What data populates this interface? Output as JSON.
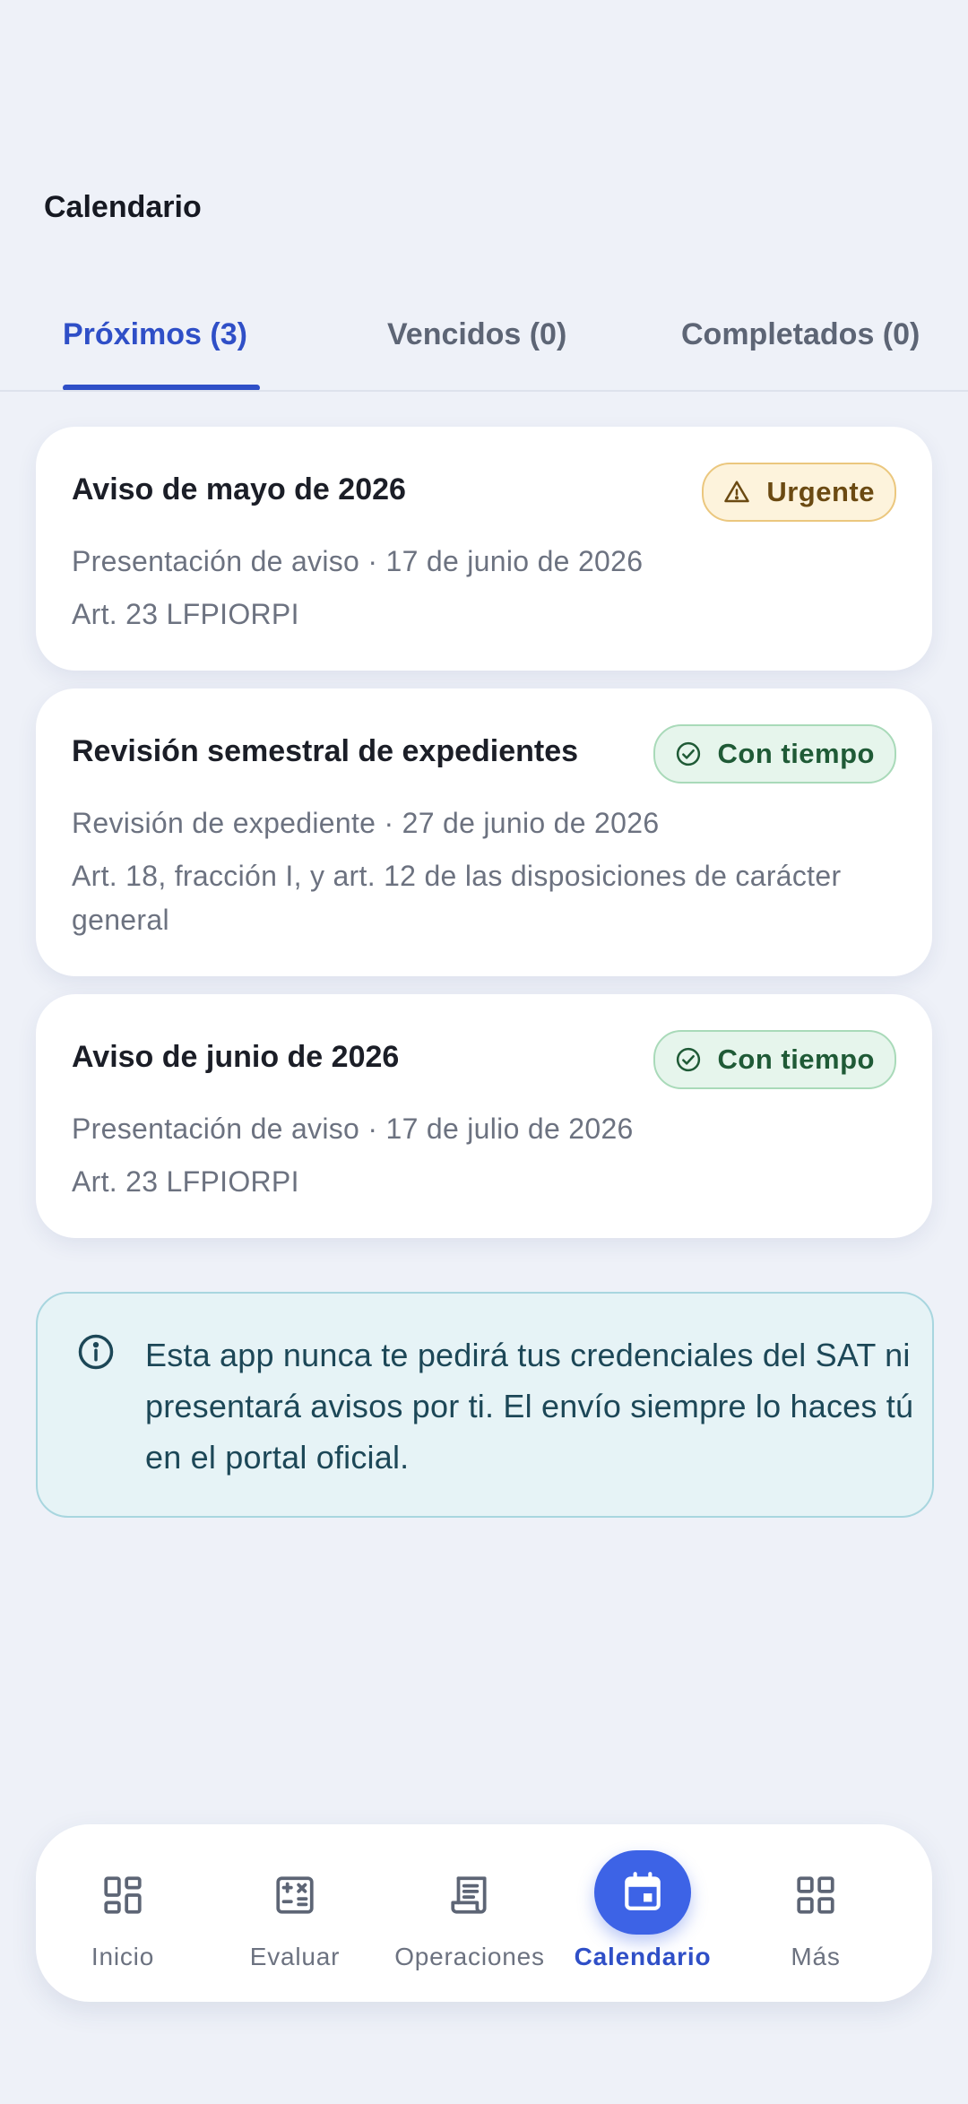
{
  "header": {
    "title": "Calendario"
  },
  "tabs": [
    {
      "label": "Próximos (3)",
      "active": true
    },
    {
      "label": "Vencidos (0)",
      "active": false
    },
    {
      "label": "Completados (0)",
      "active": false
    }
  ],
  "cards": [
    {
      "title": "Aviso de mayo de 2026",
      "meta": "Presentación de aviso · 17 de junio de 2026",
      "ref": "Art. 23 LFPIORPI",
      "badge": {
        "label": "Urgente",
        "icon": "warning-triangle-icon"
      }
    },
    {
      "title": "Revisión semestral de expedientes",
      "meta": "Revisión de expediente · 27 de junio de 2026",
      "ref": "Art. 18, fracción I, y art. 12 de las disposiciones de carácter general",
      "badge": {
        "label": "Con tiempo",
        "icon": "check-circle-icon"
      }
    },
    {
      "title": "Aviso de junio de 2026",
      "meta": "Presentación de aviso · 17 de julio de 2026",
      "ref": "Art. 23 LFPIORPI",
      "badge": {
        "label": "Con tiempo",
        "icon": "check-circle-icon"
      }
    }
  ],
  "info": {
    "icon": "info-icon",
    "text": "Esta app nunca te pedirá tus credenciales del SAT ni presentará avisos por ti. El envío siempre lo haces tú en el portal oficial."
  },
  "nav": [
    {
      "label": "Inicio",
      "icon": "dashboard-icon",
      "active": false
    },
    {
      "label": "Evaluar",
      "icon": "calculator-icon",
      "active": false
    },
    {
      "label": "Operaciones",
      "icon": "receipt-icon",
      "active": false
    },
    {
      "label": "Calendario",
      "icon": "calendar-icon",
      "active": true
    },
    {
      "label": "Más",
      "icon": "grid-icon",
      "active": false
    }
  ],
  "colors": {
    "accent": "#2f4fc7",
    "background": "#eef1f8",
    "urgent_bg": "#fdf3dc",
    "ok_bg": "#e6f5ec",
    "info_bg": "#e6f3f6"
  }
}
